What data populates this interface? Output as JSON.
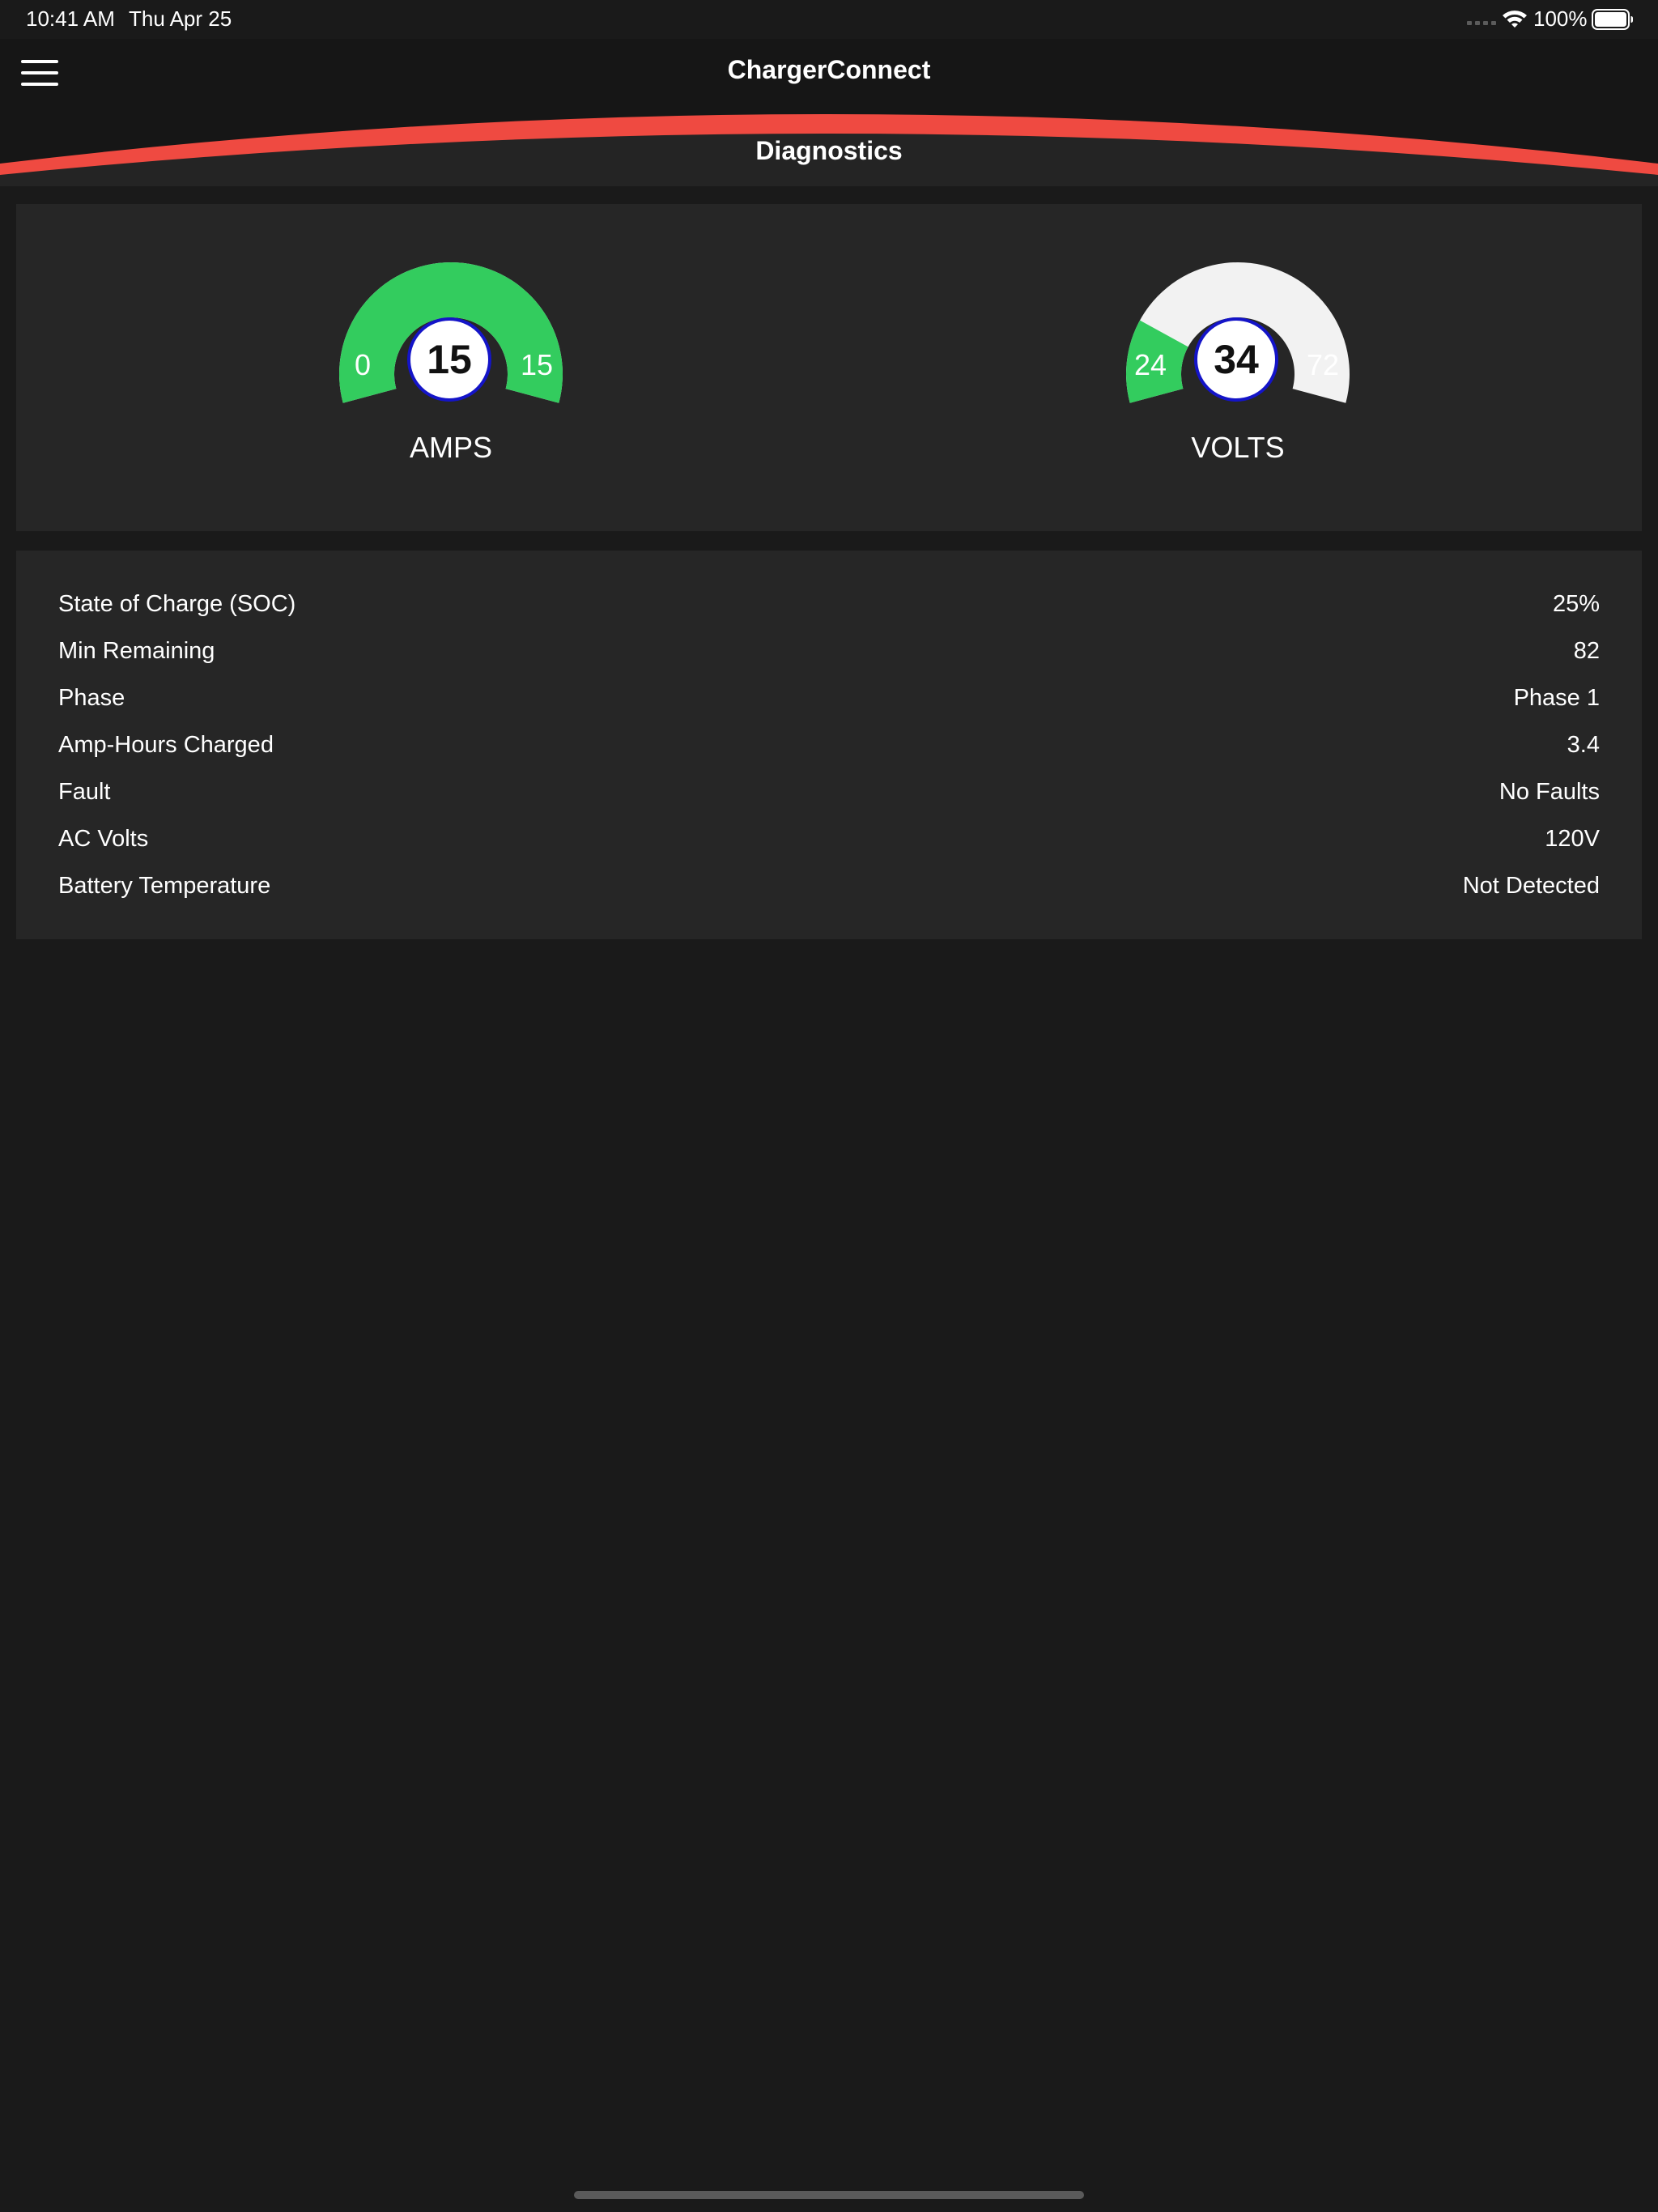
{
  "status_bar": {
    "time": "10:41 AM",
    "date": "Thu Apr 25",
    "battery_percent": "100%",
    "icons": [
      "signal-icon",
      "wifi-icon",
      "battery-icon"
    ]
  },
  "nav": {
    "app_title": "ChargerConnect",
    "section_title": "Diagnostics",
    "menu_icon": "hamburger-menu-icon",
    "accent_color": "#ef4a41"
  },
  "gauges": [
    {
      "id": "amps",
      "label": "AMPS",
      "value": "15",
      "min": "0",
      "max": "15",
      "fraction": 1.0,
      "fill_color": "#33cc5e",
      "track_color": "#f2f2f2"
    },
    {
      "id": "volts",
      "label": "VOLTS",
      "value": "34",
      "min": "24",
      "max": "72",
      "fraction": 0.2083,
      "fill_color": "#33cc5e",
      "track_color": "#f2f2f2"
    }
  ],
  "diagnostics": [
    {
      "label": "State of Charge (SOC)",
      "value": "25%"
    },
    {
      "label": "Min Remaining",
      "value": "82"
    },
    {
      "label": "Phase",
      "value": "Phase 1"
    },
    {
      "label": "Amp-Hours Charged",
      "value": "3.4"
    },
    {
      "label": "Fault",
      "value": "No Faults"
    },
    {
      "label": "AC Volts",
      "value": "120V"
    },
    {
      "label": "Battery Temperature",
      "value": "Not Detected"
    }
  ]
}
